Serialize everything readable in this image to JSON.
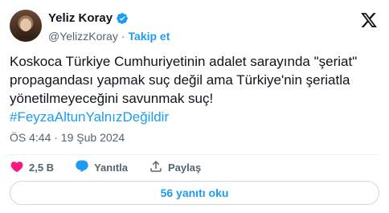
{
  "user": {
    "display_name": "Yeliz Koray",
    "handle": "@YelizzKoray",
    "separator": "·",
    "follow_label": "Takip et"
  },
  "tweet": {
    "text": "Koskoca Türkiye Cumhuriyetinin adalet sarayında \"şeriat\" propagandası yapmak suç değil ama Türkiye'nin şeriatla yönetilmeyeceğini savunmak suç!",
    "hashtag": "#FeyzaAltunYalnızDeğildir"
  },
  "meta": {
    "timestamp": "ÖS 4:44 · 19 Şub 2024"
  },
  "actions": {
    "like_count": "2,5 B",
    "reply_label": "Yanıtla",
    "share_label": "Paylaş"
  },
  "footer": {
    "read_replies_label": "56 yanıtı oku"
  },
  "colors": {
    "accent": "#1d9bf0",
    "like": "#f91880",
    "text_primary": "#0f1419",
    "text_secondary": "#536471",
    "border": "#cfd9de"
  },
  "icons": {
    "verified": "verified-badge-icon",
    "x_logo": "x-logo-icon",
    "like": "heart-icon",
    "reply": "reply-bubble-icon",
    "share": "share-upload-icon"
  }
}
